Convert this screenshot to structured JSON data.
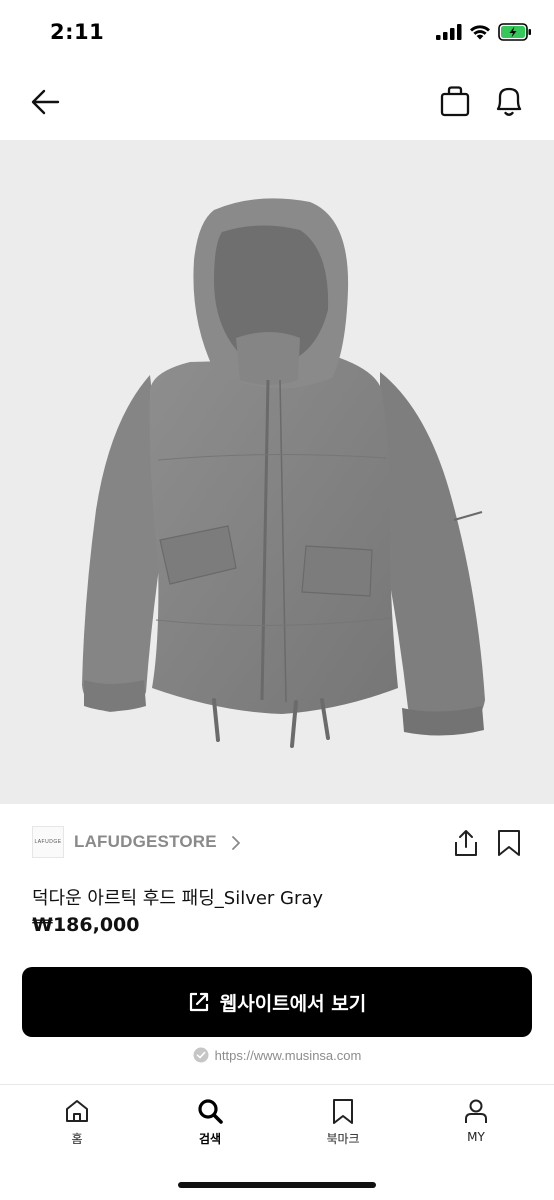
{
  "status_bar": {
    "time": "2:11"
  },
  "store": {
    "logo_text": "LAFUDGE",
    "name": "LAFUDGESTORE"
  },
  "product": {
    "title": "덕다운 아르틱 후드 패딩_Silver Gray",
    "price": "₩186,000"
  },
  "cta": {
    "label": "웹사이트에서 보기"
  },
  "source": {
    "url": "https://www.musinsa.com"
  },
  "nav": [
    {
      "label": "홈",
      "icon": "home-icon",
      "active": false
    },
    {
      "label": "검색",
      "icon": "search-icon",
      "active": true
    },
    {
      "label": "북마크",
      "icon": "bookmark-icon",
      "active": false
    },
    {
      "label": "MY",
      "icon": "user-icon",
      "active": false
    }
  ],
  "colors": {
    "cta_background": "#000000",
    "store_name": "#8a8a8a",
    "image_background": "#ececec",
    "battery": "#34c759"
  }
}
